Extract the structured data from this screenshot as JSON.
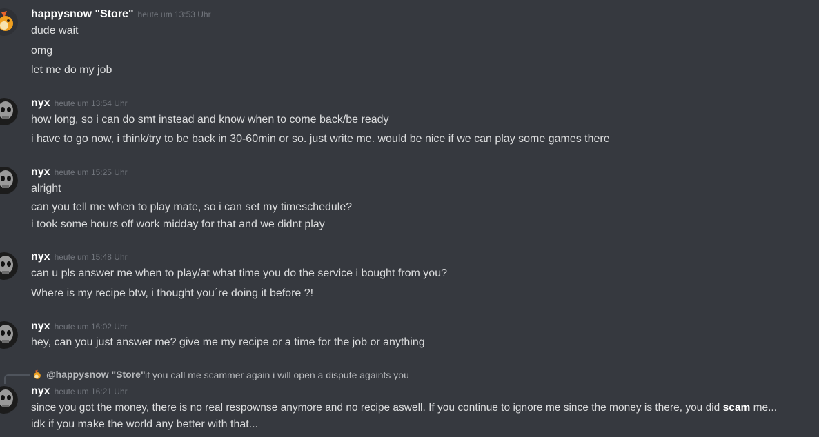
{
  "messages": [
    {
      "author": "happysnow \"Store\"",
      "time": "heute um 13:53 Uhr",
      "avatar_icon": "fox-avatar-icon",
      "lines": [
        "dude wait",
        "omg",
        "let me do my job"
      ]
    },
    {
      "author": "nyx",
      "time": "heute um 13:54 Uhr",
      "avatar_icon": "skull-avatar-icon",
      "lines": [
        "how long, so i can do smt instead and know when to come back/be ready",
        "i have to go now, i think/try to be back in 30-60min or so. just write me. would be nice if we can play some games there"
      ]
    },
    {
      "author": "nyx",
      "time": "heute um 15:25 Uhr",
      "avatar_icon": "skull-avatar-icon",
      "lines": [
        "alright",
        "can you tell me when to play mate, so i can set my timeschedule?",
        "i took some hours off work midday for that and we didnt play"
      ]
    },
    {
      "author": "nyx",
      "time": "heute um 15:48 Uhr",
      "avatar_icon": "skull-avatar-icon",
      "lines": [
        "can u pls answer me when to play/at what time you do the service i bought from you?",
        "Where is my recipe btw, i thought you´re doing it before ?!"
      ]
    },
    {
      "author": "nyx",
      "time": "heute um 16:02 Uhr",
      "avatar_icon": "skull-avatar-icon",
      "lines": [
        "hey, can you just answer me? give me my recipe or a time for the job or anything"
      ]
    },
    {
      "author": "nyx",
      "time": "heute um 16:21 Uhr",
      "avatar_icon": "skull-avatar-icon",
      "reply": {
        "author": "@happysnow \"Store\"",
        "text": "if you call me scammer again i will open a dispute againts you"
      },
      "lines_rich": {
        "l1_before": "since you got the money, there is no real respownse anymore and no recipe aswell. If you continue to ignore me since the money is there, you did ",
        "l1_bold": "scam",
        "l1_after": " me...",
        "l2": "idk if you make the world any better with that..."
      }
    }
  ],
  "colors": {
    "background": "#36393f",
    "username": "#ffffff",
    "text": "#dcddde",
    "timestamp": "#72767d",
    "reply_text": "#b9bbbe"
  }
}
